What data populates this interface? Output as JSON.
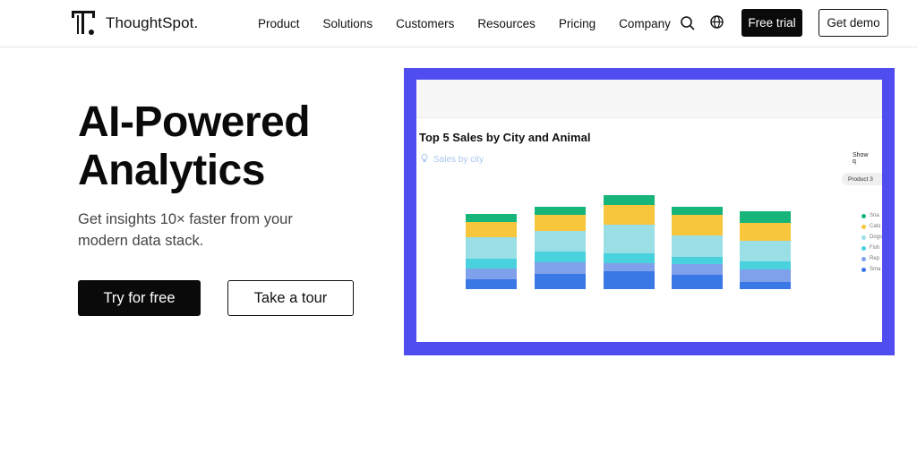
{
  "header": {
    "brand": "ThoughtSpot.",
    "nav": [
      "Product",
      "Solutions",
      "Customers",
      "Resources",
      "Pricing",
      "Company"
    ],
    "icons": [
      "search-icon",
      "globe-icon"
    ],
    "free_trial": "Free trial",
    "get_demo": "Get demo"
  },
  "hero": {
    "title_line1": "AI-Powered",
    "title_line2": "Analytics",
    "subtitle": "Get insights 10× faster from your modern data stack.",
    "primary_cta": "Try for free",
    "secondary_cta": "Take a tour"
  },
  "preview": {
    "frame_color": "#4f4cf0",
    "show_label": "Show q",
    "product_pill": "Product 3"
  },
  "chart_data": {
    "type": "bar",
    "title": "Top 5 Sales by City and Animal",
    "subtitle": "Sales by city",
    "stacked": true,
    "categories": [
      "",
      "",
      "",
      "",
      ""
    ],
    "series": [
      {
        "name": "Sma",
        "color": "#3a78e6",
        "values": [
          11,
          17,
          20,
          16,
          8
        ]
      },
      {
        "name": "Rep",
        "color": "#7fa0ea",
        "values": [
          12,
          13,
          9,
          12,
          14
        ]
      },
      {
        "name": "Fish",
        "color": "#4ad1de",
        "values": [
          11,
          12,
          11,
          8,
          9
        ]
      },
      {
        "name": "Dogs",
        "color": "#9adfe6",
        "values": [
          24,
          23,
          32,
          24,
          23
        ]
      },
      {
        "name": "Cats",
        "color": "#f7c63c",
        "values": [
          17,
          18,
          22,
          23,
          20
        ]
      },
      {
        "name": "Sna",
        "color": "#18b57a",
        "values": [
          9,
          9,
          11,
          9,
          13
        ]
      }
    ],
    "legend_labels": [
      "Sna",
      "Cats",
      "Dogs",
      "Fish",
      "Rep",
      "Sma"
    ],
    "legend": "right",
    "grid": false
  }
}
